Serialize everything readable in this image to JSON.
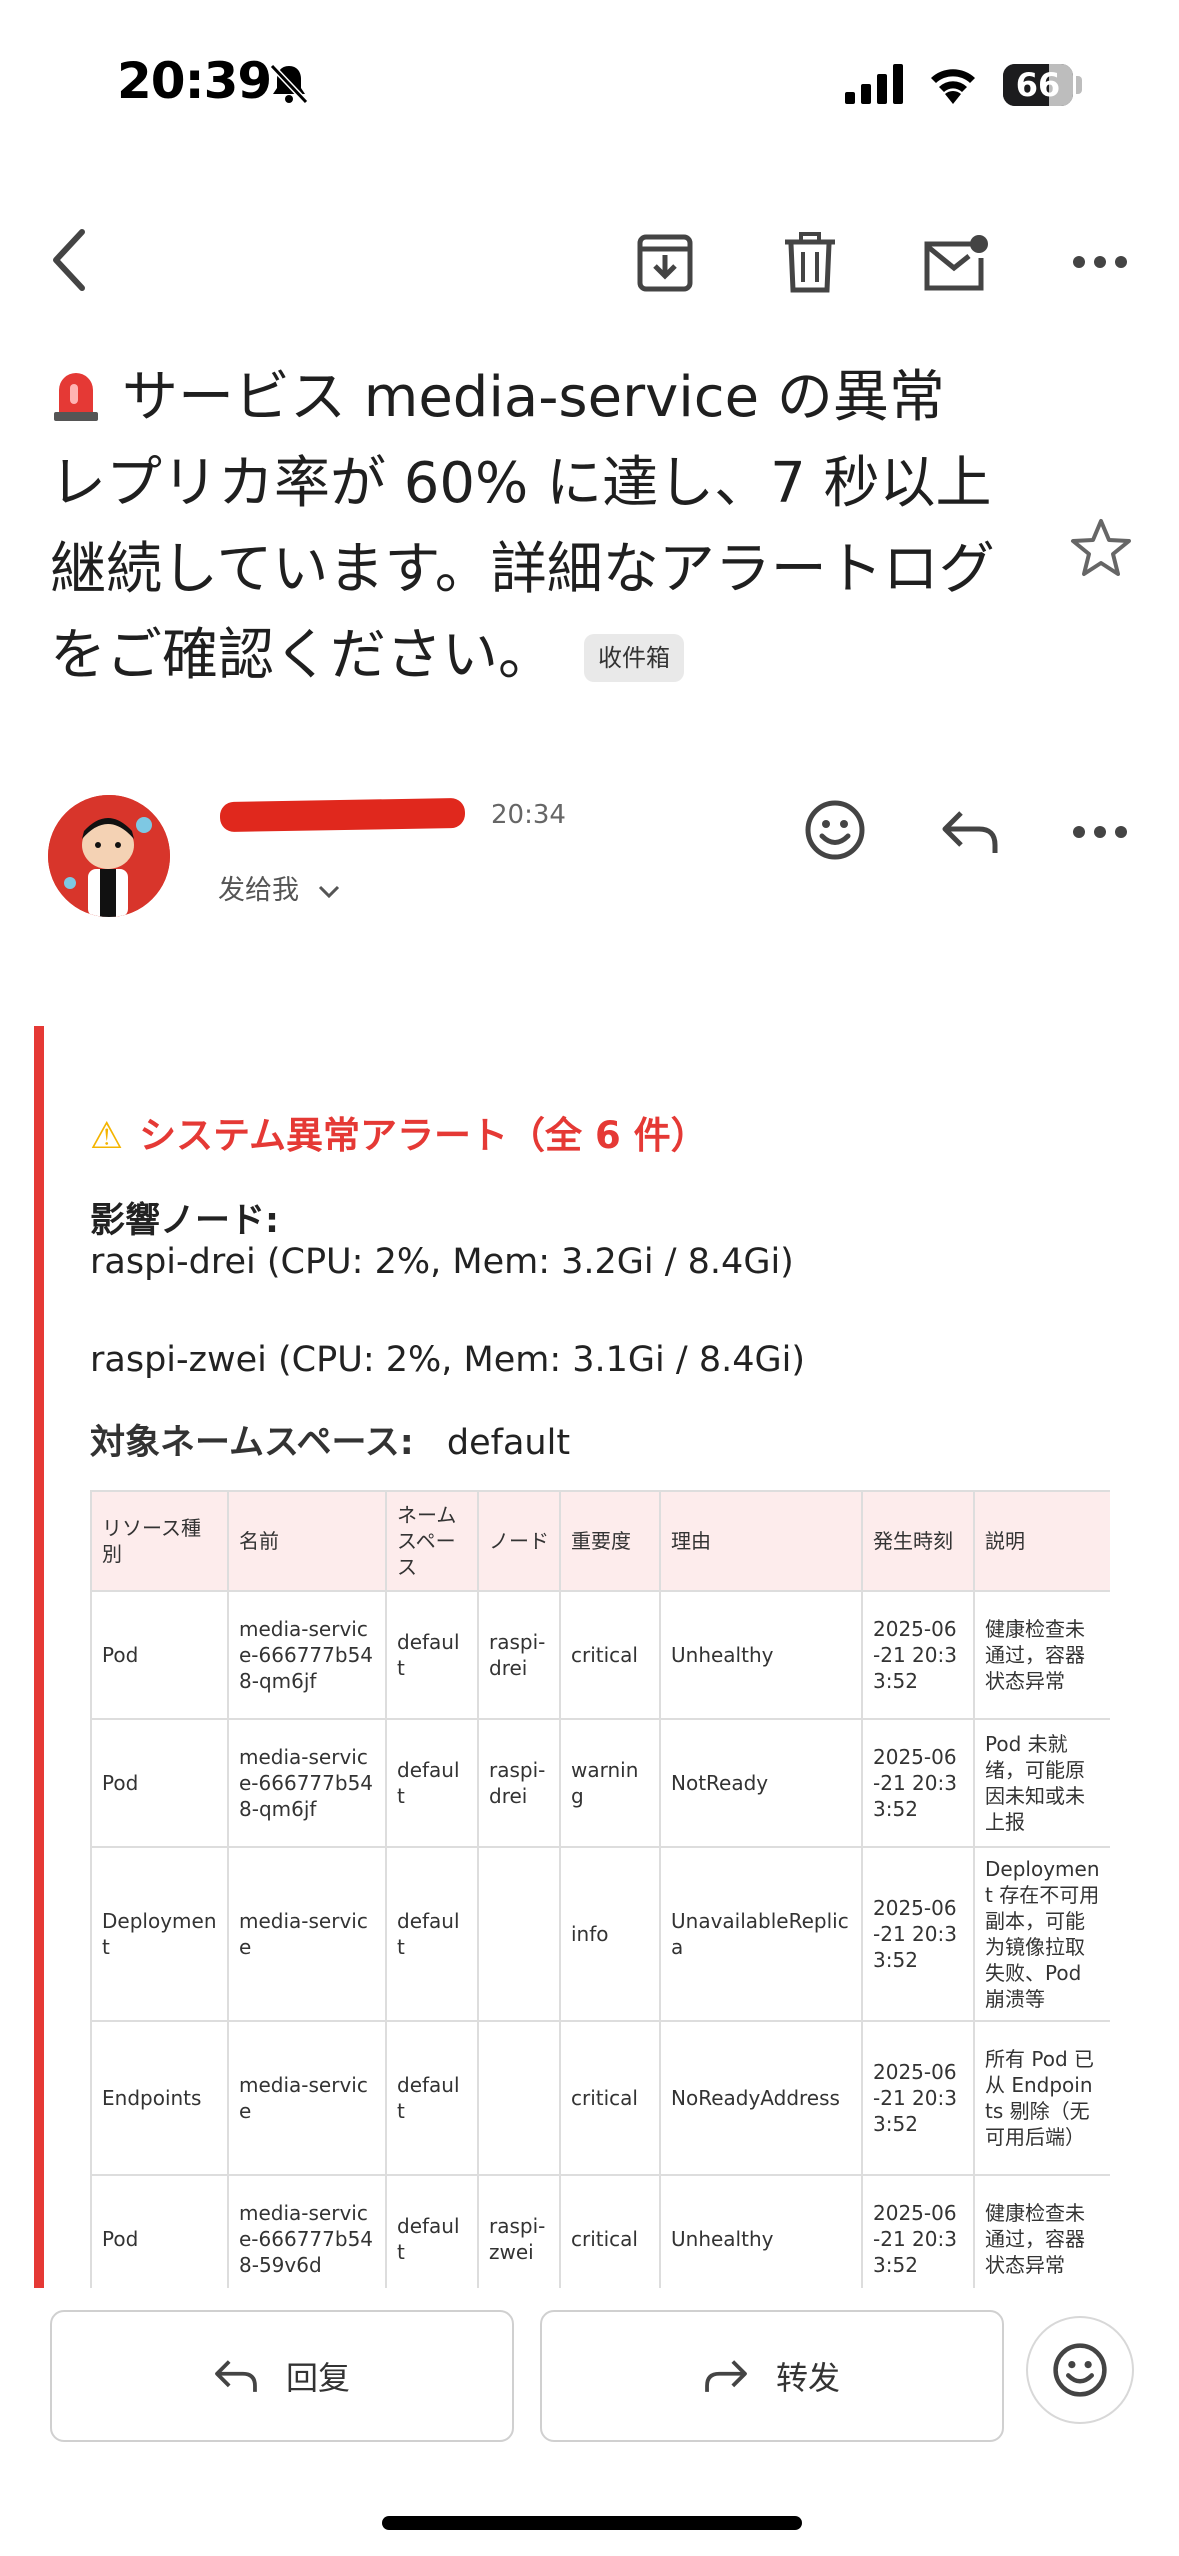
{
  "status_bar": {
    "time": "20:39",
    "battery": "66",
    "battery_level": 0.66,
    "icons": [
      "bell-off-icon",
      "cellular-signal-icon",
      "wifi-icon",
      "battery-icon"
    ]
  },
  "toolbar": {
    "icons": [
      "back-arrow-icon",
      "archive-icon",
      "trash-icon",
      "mark-unread-icon",
      "more-icon"
    ]
  },
  "email": {
    "subject": "サービス media-service の異常レプリカ率が 60% に達し、7 秒以上継続しています。詳細なアラートログをご確認ください。",
    "subject_icon": "siren-icon",
    "folder_chip": "收件箱",
    "sender_time": "20:34",
    "recipient": "发给我"
  },
  "alert": {
    "title": "システム異常アラート（全 6 件）",
    "title_icon": "warning-icon",
    "nodes_label": "影響ノード:",
    "nodes": [
      "raspi-drei (CPU: 2%, Mem: 3.2Gi / 8.4Gi)",
      "raspi-zwei (CPU: 2%, Mem: 3.1Gi / 8.4Gi)"
    ],
    "namespace_label": "対象ネームスペース:",
    "namespace": "default"
  },
  "table": {
    "headers": [
      "リソース種別",
      "名前",
      "ネームスペース",
      "ノード",
      "重要度",
      "理由",
      "発生時刻",
      "説明"
    ],
    "rows": [
      [
        "Pod",
        "media-service-666777b548-qm6jf",
        "default",
        "raspi-drei",
        "critical",
        "Unhealthy",
        "2025-06-21 20:33:52",
        "健康检查未通过，容器状态异常"
      ],
      [
        "Pod",
        "media-service-666777b548-qm6jf",
        "default",
        "raspi-drei",
        "warning",
        "NotReady",
        "2025-06-21 20:33:52",
        "Pod 未就绪，可能原因未知或未上报"
      ],
      [
        "Deployment",
        "media-service",
        "default",
        "",
        "info",
        "UnavailableReplica",
        "2025-06-21 20:33:52",
        "Deployment 存在不可用副本，可能为镜像拉取失败、Pod 崩溃等"
      ],
      [
        "Endpoints",
        "media-service",
        "default",
        "",
        "critical",
        "NoReadyAddress",
        "2025-06-21 20:33:52",
        "所有 Pod 已从 Endpoints 剔除（无可用后端）"
      ],
      [
        "Pod",
        "media-service-666777b548-59v6d",
        "default",
        "raspi-zwei",
        "critical",
        "Unhealthy",
        "2025-06-21 20:33:52",
        "健康检查未通过，容器状态异常"
      ]
    ]
  },
  "actions": {
    "reply": "回复",
    "forward": "转发"
  },
  "colors": {
    "alert_red": "#e53935",
    "header_bg": "#fdecec",
    "redaction": "#e0281d"
  }
}
